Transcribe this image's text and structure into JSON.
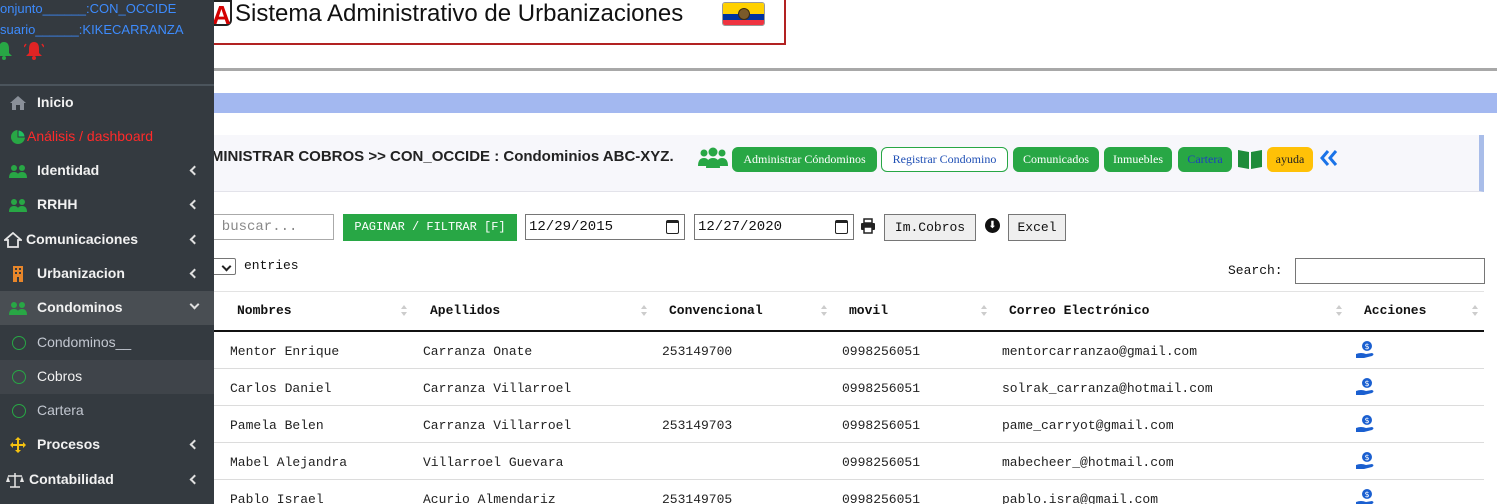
{
  "header": {
    "logo_letter": "A",
    "title": "Sistema Administrativo de Urbanizaciones"
  },
  "sidebar": {
    "conjunto_line": "onjunto______:CON_OCCIDE",
    "usuario_line": "suario______:KIKECARRANZA",
    "items": [
      {
        "label": "Inicio",
        "icon": "home-icon"
      },
      {
        "label": "Análisis / dashboard",
        "icon": "pie-chart-icon"
      },
      {
        "label": "Identidad",
        "icon": "users-icon"
      },
      {
        "label": "RRHH",
        "icon": "users-icon"
      },
      {
        "label": "Comunicaciones",
        "icon": "home-outline-icon"
      },
      {
        "label": "Urbanizacion",
        "icon": "building-icon"
      },
      {
        "label": "Condominos",
        "icon": "users-icon"
      },
      {
        "label": "Condominos__",
        "icon": "circle-icon"
      },
      {
        "label": "Cobros",
        "icon": "circle-icon"
      },
      {
        "label": "Cartera",
        "icon": "circle-icon"
      },
      {
        "label": "Procesos",
        "icon": "arrows-icon"
      },
      {
        "label": "Contabilidad",
        "icon": "scale-icon"
      }
    ]
  },
  "panel": {
    "title": "DMINISTRAR COBROS >> CON_OCCIDE : Condominios ABC-XYZ.",
    "buttons": {
      "administrar": "Administrar Cóndominos",
      "registrar": "Registrar Condomino",
      "comunicados": "Comunicados",
      "inmuebles": "Inmuebles",
      "cartera": "Cartera",
      "ayuda": "ayuda"
    }
  },
  "filters": {
    "search_placeholder": "a buscar...",
    "paginar_label": "PAGINAR / FILTRAR [F]",
    "date_from": "12/29/2015",
    "date_to": "12/27/2020",
    "imprimir_label": "Im.Cobros",
    "excel_label": "Excel",
    "entries_label": "entries",
    "search_label": "Search:"
  },
  "table": {
    "headers": [
      "Nombres",
      "Apellidos",
      "Convencional",
      "movil",
      "Correo Electrónico",
      "Acciones"
    ],
    "rows": [
      {
        "nombres": "Mentor Enrique",
        "apellidos": "Carranza Onate",
        "convencional": "253149700",
        "movil": "0998256051",
        "correo": "mentorcarranzao@gmail.com"
      },
      {
        "nombres": "Carlos Daniel",
        "apellidos": "Carranza Villarroel",
        "convencional": "",
        "movil": "0998256051",
        "correo": "solrak_carranza@hotmail.com"
      },
      {
        "nombres": "Pamela Belen",
        "apellidos": "Carranza Villarroel",
        "convencional": "253149703",
        "movil": "0998256051",
        "correo": "pame_carryot@gmail.com"
      },
      {
        "nombres": "Mabel Alejandra",
        "apellidos": "Villarroel Guevara",
        "convencional": "",
        "movil": "0998256051",
        "correo": "mabecheer_@hotmail.com"
      },
      {
        "nombres": "Pablo Israel",
        "apellidos": "Acurio Almendariz",
        "convencional": "253149705",
        "movil": "0998256051",
        "correo": "pablo.isra@gmail.com"
      }
    ]
  },
  "colors": {
    "sidebar_bg": "#343a40",
    "green": "#28a745",
    "yellow": "#ffc107",
    "blue_bar": "#a3b8f0",
    "link_blue": "#3d8bfd"
  }
}
